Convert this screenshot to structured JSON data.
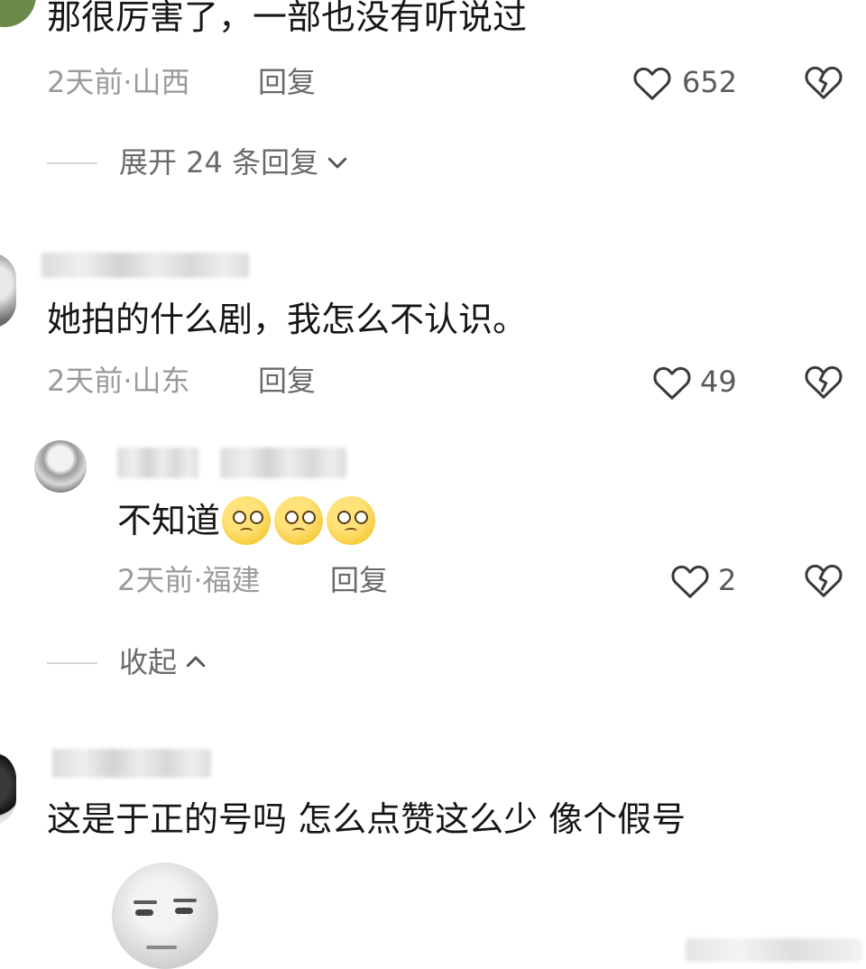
{
  "comments": [
    {
      "text": "那很厉害了，一部也没有听说过",
      "time": "2天前",
      "location": "山西",
      "reply_label": "回复",
      "likes": "652",
      "replies_toggle": "展开 24 条回复"
    },
    {
      "text": "她拍的什么剧，我怎么不认识。",
      "time": "2天前",
      "location": "山东",
      "reply_label": "回复",
      "likes": "49",
      "replies": [
        {
          "text": "不知道",
          "emoji_count": 3,
          "time": "2天前",
          "location": "福建",
          "reply_label": "回复",
          "likes": "2"
        }
      ],
      "collapse_toggle": "收起"
    },
    {
      "text": "这是于正的号吗 怎么点赞这么少 像个假号"
    }
  ],
  "meta_separator": "·",
  "colors": {
    "text": "#161616",
    "meta": "#9a9a9a",
    "icon": "#3a3a3a",
    "emoji": "#f6cb3c"
  },
  "icons": {
    "like": "heart-outline-icon",
    "dislike": "broken-heart-icon",
    "expand": "chevron-down-icon",
    "collapse": "chevron-up-icon"
  }
}
